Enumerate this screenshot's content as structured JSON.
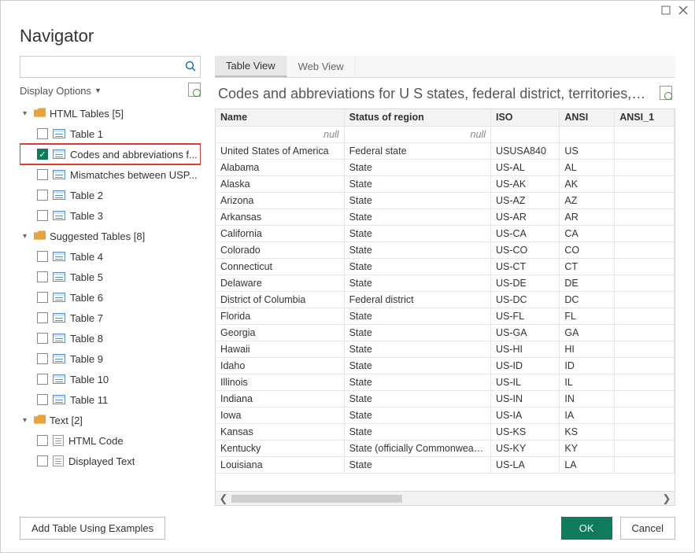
{
  "window": {
    "title": "Navigator"
  },
  "search": {
    "placeholder": ""
  },
  "display_options": {
    "label": "Display Options"
  },
  "tabs": {
    "table_view": "Table View",
    "web_view": "Web View"
  },
  "preview": {
    "title": "Codes and abbreviations for U S states, federal district, territories,…"
  },
  "columns": {
    "name": "Name",
    "status": "Status of region",
    "iso": "ISO",
    "ansi": "ANSI",
    "ansi1": "ANSI_1"
  },
  "filter_null": "null",
  "tree": {
    "groups": [
      {
        "label": "HTML Tables [5]",
        "items": [
          {
            "label": "Table 1",
            "checked": false,
            "icon": "table",
            "highlight": false
          },
          {
            "label": "Codes and abbreviations f...",
            "checked": true,
            "icon": "table",
            "highlight": true
          },
          {
            "label": "Mismatches between USP...",
            "checked": false,
            "icon": "table",
            "highlight": false
          },
          {
            "label": "Table 2",
            "checked": false,
            "icon": "table",
            "highlight": false
          },
          {
            "label": "Table 3",
            "checked": false,
            "icon": "table",
            "highlight": false
          }
        ]
      },
      {
        "label": "Suggested Tables [8]",
        "items": [
          {
            "label": "Table 4",
            "checked": false,
            "icon": "table"
          },
          {
            "label": "Table 5",
            "checked": false,
            "icon": "table"
          },
          {
            "label": "Table 6",
            "checked": false,
            "icon": "table"
          },
          {
            "label": "Table 7",
            "checked": false,
            "icon": "table"
          },
          {
            "label": "Table 8",
            "checked": false,
            "icon": "table"
          },
          {
            "label": "Table 9",
            "checked": false,
            "icon": "table"
          },
          {
            "label": "Table 10",
            "checked": false,
            "icon": "table"
          },
          {
            "label": "Table 11",
            "checked": false,
            "icon": "table"
          }
        ]
      },
      {
        "label": "Text [2]",
        "items": [
          {
            "label": "HTML Code",
            "checked": false,
            "icon": "text"
          },
          {
            "label": "Displayed Text",
            "checked": false,
            "icon": "text"
          }
        ]
      }
    ]
  },
  "rows": [
    {
      "name": "United States of America",
      "status": "Federal state",
      "iso": "USUSA840",
      "ansi": "US",
      "ansi1": ""
    },
    {
      "name": "Alabama",
      "status": "State",
      "iso": "US-AL",
      "ansi": "AL",
      "ansi1": ""
    },
    {
      "name": "Alaska",
      "status": "State",
      "iso": "US-AK",
      "ansi": "AK",
      "ansi1": ""
    },
    {
      "name": "Arizona",
      "status": "State",
      "iso": "US-AZ",
      "ansi": "AZ",
      "ansi1": ""
    },
    {
      "name": "Arkansas",
      "status": "State",
      "iso": "US-AR",
      "ansi": "AR",
      "ansi1": ""
    },
    {
      "name": "California",
      "status": "State",
      "iso": "US-CA",
      "ansi": "CA",
      "ansi1": ""
    },
    {
      "name": "Colorado",
      "status": "State",
      "iso": "US-CO",
      "ansi": "CO",
      "ansi1": ""
    },
    {
      "name": "Connecticut",
      "status": "State",
      "iso": "US-CT",
      "ansi": "CT",
      "ansi1": ""
    },
    {
      "name": "Delaware",
      "status": "State",
      "iso": "US-DE",
      "ansi": "DE",
      "ansi1": ""
    },
    {
      "name": "District of Columbia",
      "status": "Federal district",
      "iso": "US-DC",
      "ansi": "DC",
      "ansi1": ""
    },
    {
      "name": "Florida",
      "status": "State",
      "iso": "US-FL",
      "ansi": "FL",
      "ansi1": ""
    },
    {
      "name": "Georgia",
      "status": "State",
      "iso": "US-GA",
      "ansi": "GA",
      "ansi1": ""
    },
    {
      "name": "Hawaii",
      "status": "State",
      "iso": "US-HI",
      "ansi": "HI",
      "ansi1": ""
    },
    {
      "name": "Idaho",
      "status": "State",
      "iso": "US-ID",
      "ansi": "ID",
      "ansi1": ""
    },
    {
      "name": "Illinois",
      "status": "State",
      "iso": "US-IL",
      "ansi": "IL",
      "ansi1": ""
    },
    {
      "name": "Indiana",
      "status": "State",
      "iso": "US-IN",
      "ansi": "IN",
      "ansi1": ""
    },
    {
      "name": "Iowa",
      "status": "State",
      "iso": "US-IA",
      "ansi": "IA",
      "ansi1": ""
    },
    {
      "name": "Kansas",
      "status": "State",
      "iso": "US-KS",
      "ansi": "KS",
      "ansi1": ""
    },
    {
      "name": "Kentucky",
      "status": "State (officially Commonwealth)",
      "iso": "US-KY",
      "ansi": "KY",
      "ansi1": ""
    },
    {
      "name": "Louisiana",
      "status": "State",
      "iso": "US-LA",
      "ansi": "LA",
      "ansi1": ""
    }
  ],
  "buttons": {
    "add_using_examples": "Add Table Using Examples",
    "ok": "OK",
    "cancel": "Cancel"
  }
}
